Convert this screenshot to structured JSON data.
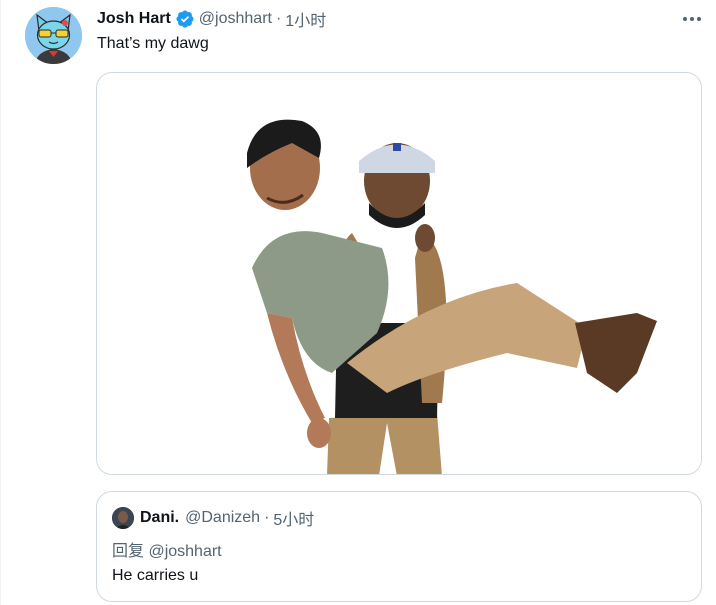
{
  "tweet": {
    "author_name": "Josh Hart",
    "handle": "@joshhart",
    "separator": "·",
    "time": "1小时",
    "text": "That’s my dawg",
    "verified": true
  },
  "icons": {
    "verified": "verified-badge-icon",
    "more": "more-options-icon"
  },
  "quote": {
    "author_name": "Dani.",
    "handle": "@Danizeh",
    "separator": "·",
    "time": "5小时",
    "reply_prefix": "回复 ",
    "reply_mention": "@joshhart",
    "text": "He carries u"
  },
  "colors": {
    "text": "#0f1419",
    "secondary": "#536471",
    "border": "#cfd9de",
    "verified": "#1d9bf0",
    "avatar_bg": "#8fc7ef"
  }
}
